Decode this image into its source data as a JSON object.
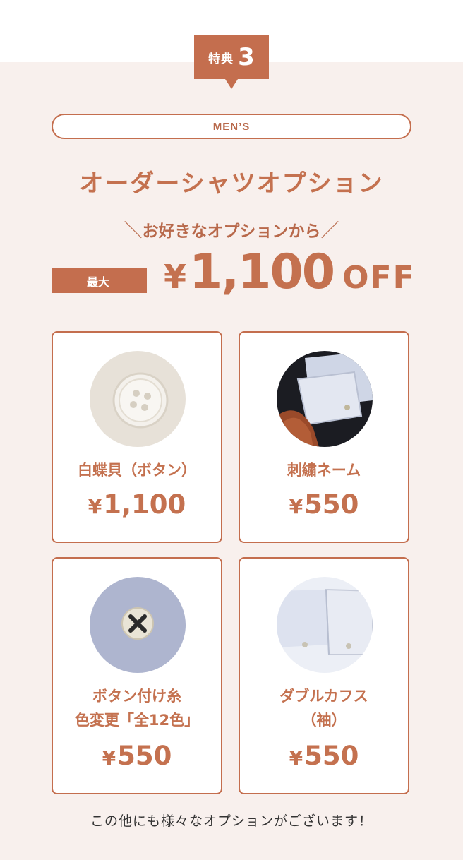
{
  "badge": {
    "label": "特典",
    "number": "3"
  },
  "category": "MEN’S",
  "title": "オーダーシャツオプション",
  "subtitle": {
    "left_slash": "＼",
    "text": "お好きなオプションから",
    "right_slash": "／"
  },
  "max_label": "最大",
  "discount": {
    "yen": "¥",
    "amount": "1,100",
    "suffix": "OFF"
  },
  "options": [
    {
      "name": "白蝶貝（ボタン）",
      "name_line2": "",
      "yen": "¥",
      "price": "1,100",
      "icon": "shell-button-photo"
    },
    {
      "name": "刺繍ネーム",
      "name_line2": "",
      "yen": "¥",
      "price": "550",
      "icon": "embroidered-cuff-photo"
    },
    {
      "name": "ボタン付け糸",
      "name_line2": "色変更「全12色」",
      "yen": "¥",
      "price": "550",
      "icon": "button-thread-photo"
    },
    {
      "name": "ダブルカフス",
      "name_line2": "（袖）",
      "yen": "¥",
      "price": "550",
      "icon": "double-cuff-photo"
    }
  ],
  "footer": "この他にも様々なオプションがございます！",
  "colors": {
    "accent": "#c46e4e",
    "panel_bg": "#f8f0ed",
    "text_dark": "#333333"
  }
}
